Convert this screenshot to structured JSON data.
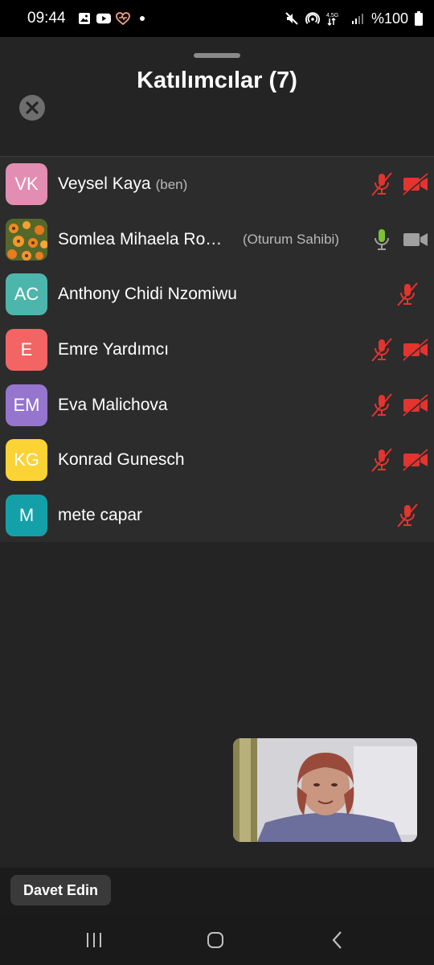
{
  "status_bar": {
    "time": "09:44",
    "battery": "%100",
    "network": "4,5G",
    "left_icons": [
      "gallery-icon",
      "youtube-icon",
      "health-icon",
      "dot-icon"
    ],
    "right_icons": [
      "mute-icon",
      "hotspot-icon",
      "network-arrows-icon",
      "signal-icon",
      "battery-icon"
    ]
  },
  "header": {
    "title": "Katılımcılar (7)"
  },
  "participants": [
    {
      "initials": "VK",
      "name": "Veysel Kaya",
      "tag": "(ben)",
      "avatar_color": "#e38db3",
      "mic": "muted",
      "camera": "off"
    },
    {
      "initials": "",
      "name": "Somlea Mihaela  Ro…",
      "tag": "(Oturum Sahibi)",
      "avatar_color": "#6b7a2a",
      "mic": "on",
      "camera": "on",
      "avatar_image": "orange-flowers-photo"
    },
    {
      "initials": "AC",
      "name": "Anthony Chidi Nzomiwu",
      "tag": "",
      "avatar_color": "#4db6ac",
      "mic": "muted",
      "camera": "none"
    },
    {
      "initials": "E",
      "name": "Emre Yardımcı",
      "tag": "",
      "avatar_color": "#f36464",
      "mic": "muted",
      "camera": "off"
    },
    {
      "initials": "EM",
      "name": "Eva Malichova",
      "tag": "",
      "avatar_color": "#9575cd",
      "mic": "muted",
      "camera": "off"
    },
    {
      "initials": "KG",
      "name": "Konrad Gunesch",
      "tag": "",
      "avatar_color": "#fbd335",
      "mic": "muted",
      "camera": "off"
    },
    {
      "initials": "M",
      "name": "mete capar",
      "tag": "",
      "avatar_color": "#14a0a8",
      "mic": "muted",
      "camera": "none"
    }
  ],
  "colors": {
    "muted_red": "#e3342f",
    "mic_on_green": "#7cc332",
    "camera_on_gray": "#a0a0a0"
  },
  "bottom": {
    "invite_label": "Davet Edin"
  },
  "navbar": {
    "items": [
      "recents-icon",
      "home-icon",
      "back-icon"
    ]
  }
}
